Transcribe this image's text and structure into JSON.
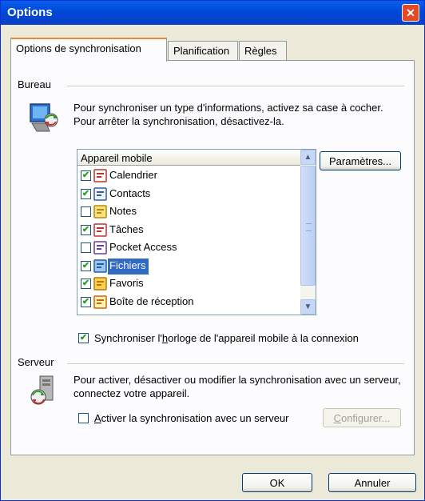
{
  "window": {
    "title": "Options",
    "close_glyph": "✕"
  },
  "tabs": [
    {
      "label": "Options de synchronisation",
      "active": true
    },
    {
      "label": "Planification",
      "active": false
    },
    {
      "label": "Règles",
      "active": false
    }
  ],
  "bureau": {
    "label": "Bureau",
    "description": "Pour synchroniser un type d'informations, activez sa case à cocher. Pour arrêter la synchronisation, désactivez-la.",
    "list_header": "Appareil mobile",
    "params_button": "Paramètres...",
    "items": [
      {
        "label": "Calendrier",
        "checked": true,
        "icon": "calendar-icon",
        "selected": false
      },
      {
        "label": "Contacts",
        "checked": true,
        "icon": "contacts-icon",
        "selected": false
      },
      {
        "label": "Notes",
        "checked": false,
        "icon": "notes-icon",
        "selected": false
      },
      {
        "label": "Tâches",
        "checked": true,
        "icon": "tasks-icon",
        "selected": false
      },
      {
        "label": "Pocket Access",
        "checked": false,
        "icon": "pocket-access-icon",
        "selected": false
      },
      {
        "label": "Fichiers",
        "checked": true,
        "icon": "files-icon",
        "selected": true
      },
      {
        "label": "Favoris",
        "checked": true,
        "icon": "favorites-icon",
        "selected": false
      },
      {
        "label": "Boîte de réception",
        "checked": true,
        "icon": "inbox-icon",
        "selected": false
      }
    ],
    "sync_clock_label_pre": "Synchroniser l'",
    "sync_clock_label_u": "h",
    "sync_clock_label_post": "orloge de l'appareil mobile à la connexion",
    "sync_clock_checked": true,
    "check_glyph": "✔"
  },
  "serveur": {
    "label": "Serveur",
    "description": "Pour activer, désactiver ou modifier la synchronisation avec un serveur, connectez votre appareil.",
    "enable_u": "A",
    "enable_post": "ctiver la synchronisation avec un serveur",
    "enable_checked": false,
    "configure_u": "C",
    "configure_post": "onfigurer..."
  },
  "footer": {
    "ok": "OK",
    "cancel": "Annuler"
  },
  "colors": {
    "titlebar": "#0048D8",
    "selection": "#316AC5",
    "face": "#ECE9D8"
  }
}
